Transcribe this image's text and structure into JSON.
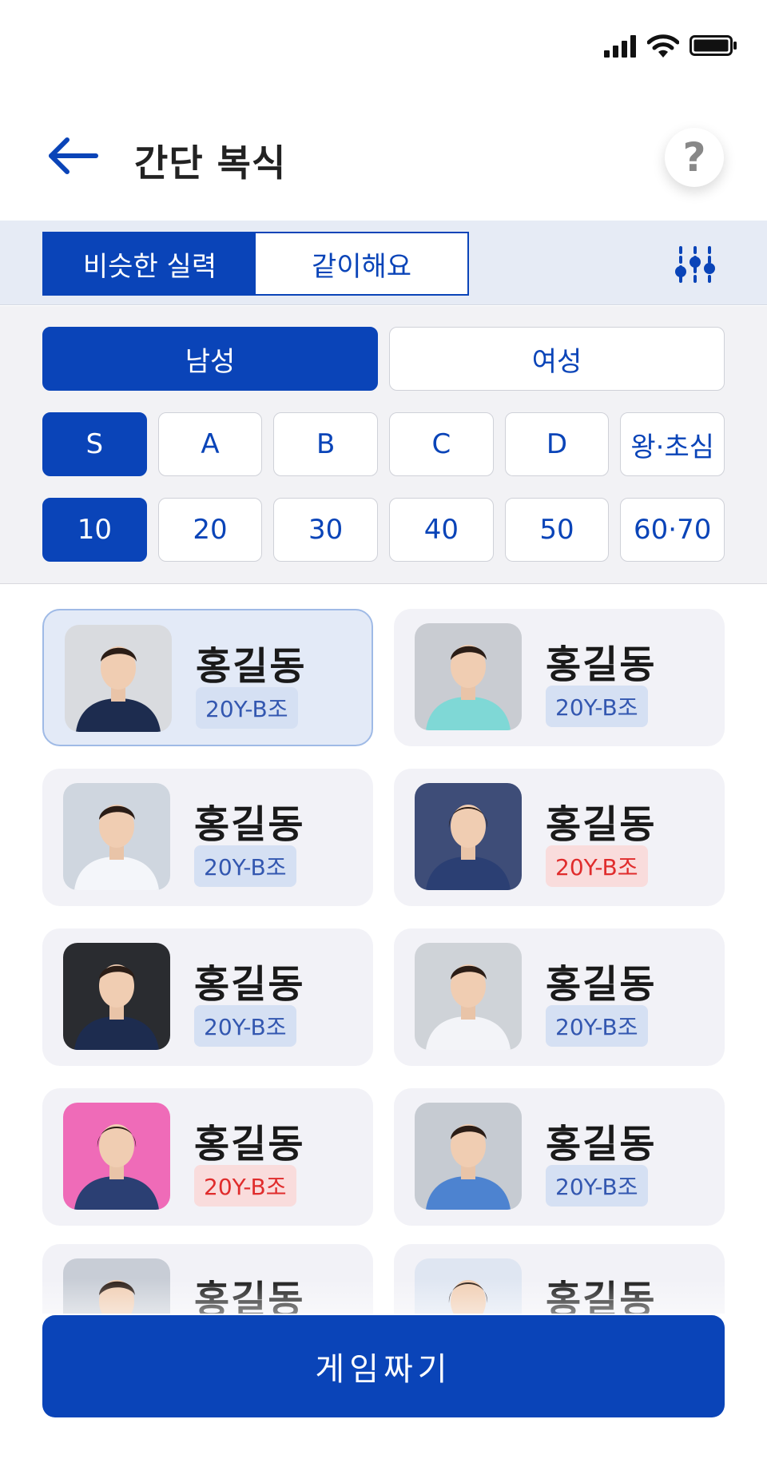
{
  "header": {
    "title": "간단 복식",
    "help_label": "?"
  },
  "mode_tabs": [
    {
      "label": "비슷한 실력",
      "active": true
    },
    {
      "label": "같이해요",
      "active": false
    }
  ],
  "gender": [
    {
      "label": "남성",
      "active": true
    },
    {
      "label": "여성",
      "active": false
    }
  ],
  "grades": [
    {
      "label": "S",
      "active": true
    },
    {
      "label": "A",
      "active": false
    },
    {
      "label": "B",
      "active": false
    },
    {
      "label": "C",
      "active": false
    },
    {
      "label": "D",
      "active": false
    },
    {
      "label": "왕·초심",
      "active": false
    }
  ],
  "ages": [
    {
      "label": "10",
      "active": true
    },
    {
      "label": "20",
      "active": false
    },
    {
      "label": "30",
      "active": false
    },
    {
      "label": "40",
      "active": false
    },
    {
      "label": "50",
      "active": false
    },
    {
      "label": "60·70",
      "active": false
    }
  ],
  "players": [
    {
      "name": "홍길동",
      "badge": "20Y-B조",
      "gender": "male",
      "selected": true
    },
    {
      "name": "홍길동",
      "badge": "20Y-B조",
      "gender": "male",
      "selected": false
    },
    {
      "name": "홍길동",
      "badge": "20Y-B조",
      "gender": "male",
      "selected": false
    },
    {
      "name": "홍길동",
      "badge": "20Y-B조",
      "gender": "female",
      "selected": false
    },
    {
      "name": "홍길동",
      "badge": "20Y-B조",
      "gender": "male",
      "selected": false
    },
    {
      "name": "홍길동",
      "badge": "20Y-B조",
      "gender": "male",
      "selected": false
    },
    {
      "name": "홍길동",
      "badge": "20Y-B조",
      "gender": "female",
      "selected": false
    },
    {
      "name": "홍길동",
      "badge": "20Y-B조",
      "gender": "male",
      "selected": false
    },
    {
      "name": "홍길동",
      "badge": "",
      "gender": "male",
      "selected": false
    },
    {
      "name": "홍길동",
      "badge": "",
      "gender": "female",
      "selected": false
    }
  ],
  "action": {
    "label": "게임짜기"
  },
  "colors": {
    "primary": "#0a44b8",
    "female_badge": "#e02c2c",
    "male_badge": "#3357b0"
  }
}
